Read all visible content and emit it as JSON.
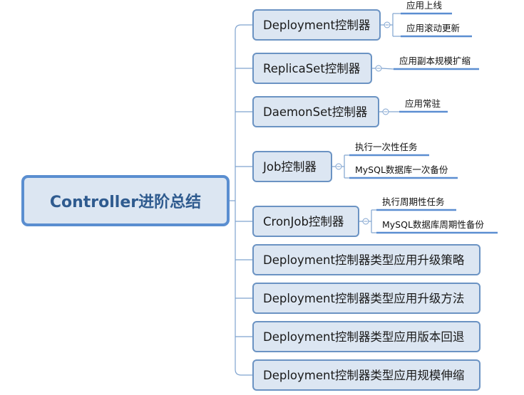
{
  "root": {
    "title": "Controller进阶总结"
  },
  "colors": {
    "root_border": "#5a8ed0",
    "root_fill": "#dce6f2",
    "root_text": "#2f5b8f",
    "node_border": "#6b93c3",
    "node_fill": "#dce6f2",
    "node_text": "#1a1a1a",
    "leaf_underline": "#5b8ed1",
    "connector": "#7fa3cf"
  },
  "branches": [
    {
      "label": "Deployment控制器",
      "leaves": [
        "应用上线",
        "应用滚动更新"
      ]
    },
    {
      "label": "ReplicaSet控制器",
      "leaves": [
        "应用副本规模扩缩"
      ]
    },
    {
      "label": "DaemonSet控制器",
      "leaves": [
        "应用常驻"
      ]
    },
    {
      "label": "Job控制器",
      "leaves": [
        "执行一次性任务",
        "MySQL数据库一次备份"
      ]
    },
    {
      "label": "CronJob控制器",
      "leaves": [
        "执行周期性任务",
        "MySQL数据库周期性备份"
      ]
    },
    {
      "label": "Deployment控制器类型应用升级策略",
      "leaves": []
    },
    {
      "label": "Deployment控制器类型应用升级方法",
      "leaves": []
    },
    {
      "label": "Deployment控制器类型应用版本回退",
      "leaves": []
    },
    {
      "label": "Deployment控制器类型应用规模伸缩",
      "leaves": []
    }
  ]
}
